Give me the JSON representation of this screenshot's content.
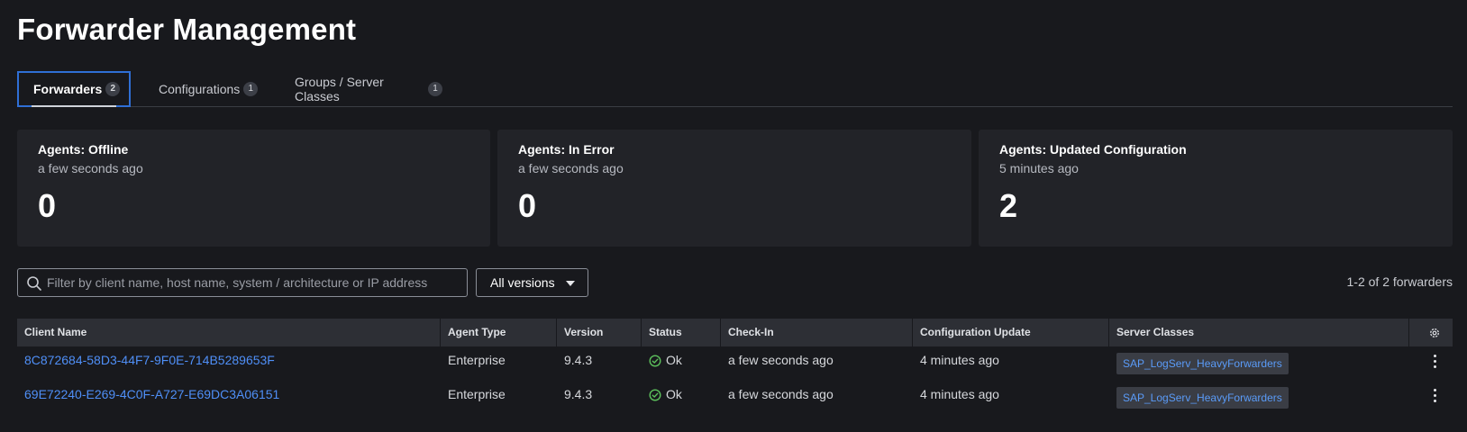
{
  "page_title": "Forwarder Management",
  "tabs": [
    {
      "label": "Forwarders",
      "count": "2"
    },
    {
      "label": "Configurations",
      "count": "1"
    },
    {
      "label": "Groups / Server Classes",
      "count": "1"
    }
  ],
  "cards": [
    {
      "title": "Agents: Offline",
      "subtitle": "a few seconds ago",
      "value": "0"
    },
    {
      "title": "Agents: In Error",
      "subtitle": "a few seconds ago",
      "value": "0"
    },
    {
      "title": "Agents: Updated Configuration",
      "subtitle": "5 minutes ago",
      "value": "2"
    }
  ],
  "filter": {
    "placeholder": "Filter by client name, host name, system / architecture or IP address",
    "value": "",
    "version_select": "All versions",
    "range_text": "1-2 of 2 forwarders"
  },
  "table": {
    "columns": [
      "Client Name",
      "Agent Type",
      "Version",
      "Status",
      "Check-In",
      "Configuration Update",
      "Server Classes"
    ],
    "rows": [
      {
        "client_name": "8C872684-58D3-44F7-9F0E-714B5289653F",
        "agent_type": "Enterprise",
        "version": "9.4.3",
        "status": "Ok",
        "check_in": "a few seconds ago",
        "config_update": "4 minutes ago",
        "server_class": "SAP_LogServ_HeavyForwarders"
      },
      {
        "client_name": "69E72240-E269-4C0F-A727-E69DC3A06151",
        "agent_type": "Enterprise",
        "version": "9.4.3",
        "status": "Ok",
        "check_in": "a few seconds ago",
        "config_update": "4 minutes ago",
        "server_class": "SAP_LogServ_HeavyForwarders"
      }
    ]
  },
  "icons": {
    "search": "search-icon",
    "status_ok": "check-circle-icon",
    "settings": "gear-icon",
    "row_menu": "kebab-menu-icon",
    "select_caret": "caret-down-icon"
  },
  "colors": {
    "background": "#18191d",
    "card": "#222328",
    "link": "#4f8ff7",
    "ok": "#5cc05c",
    "active_tab_border": "#2f6fd6"
  }
}
